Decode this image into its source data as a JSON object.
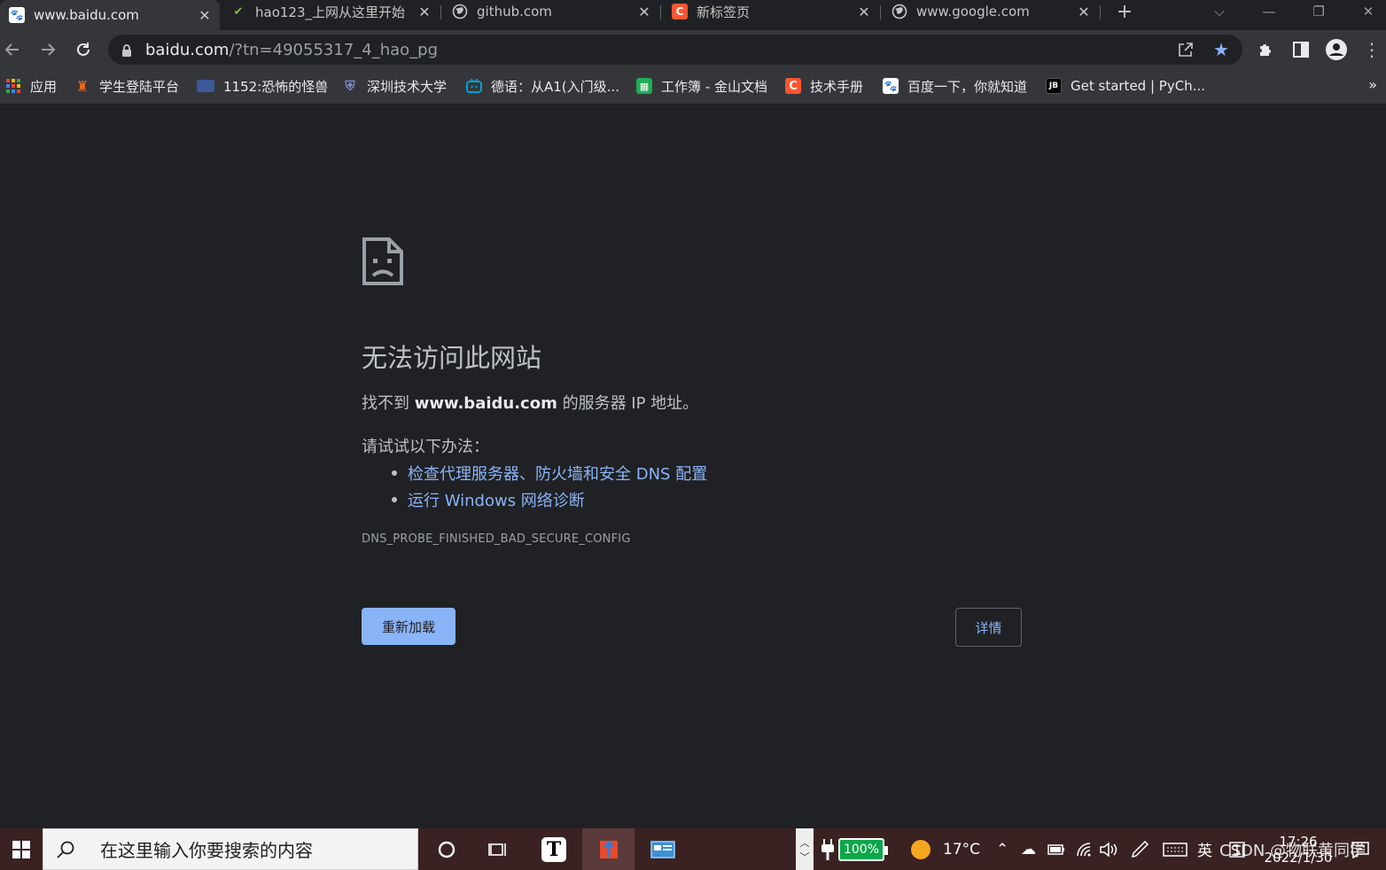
{
  "tabs": [
    {
      "title": "www.baidu.com",
      "active": true
    },
    {
      "title": "hao123_上网从这里开始",
      "active": false
    },
    {
      "title": "github.com",
      "active": false
    },
    {
      "title": "新标签页",
      "active": false
    },
    {
      "title": "www.google.com",
      "active": false
    }
  ],
  "toolbar": {
    "url_host": "baidu.com",
    "url_path": "/?tn=49055317_4_hao_pg"
  },
  "bookmarks": [
    {
      "label": "应用",
      "icon": "apps-grid-icon"
    },
    {
      "label": "学生登陆平台",
      "icon": "shield-bookmark-icon"
    },
    {
      "label": "1152:恐怖的怪兽",
      "icon": "image-bookmark-icon"
    },
    {
      "label": "深圳技术大学",
      "icon": "university-bookmark-icon"
    },
    {
      "label": "德语：从A1(入门级...",
      "icon": "bilibili-icon"
    },
    {
      "label": "工作簿 - 金山文档",
      "icon": "spreadsheet-icon"
    },
    {
      "label": "技术手册",
      "icon": "csdn-icon"
    },
    {
      "label": "百度一下，你就知道",
      "icon": "baidu-paw-icon"
    },
    {
      "label": "Get started | PyCh...",
      "icon": "jetbrains-icon"
    }
  ],
  "error": {
    "title": "无法访问此网站",
    "desc_prefix": "找不到 ",
    "desc_host": "www.baidu.com",
    "desc_suffix": " 的服务器 IP 地址。",
    "try_label": "请试试以下办法：",
    "suggestions": [
      "检查代理服务器、防火墙和安全 DNS 配置",
      "运行 Windows 网络诊断"
    ],
    "code": "DNS_PROBE_FINISHED_BAD_SECURE_CONFIG",
    "reload_label": "重新加载",
    "details_label": "详情"
  },
  "taskbar": {
    "search_placeholder": "在这里输入你要搜索的内容",
    "battery": "100%",
    "temperature": "17°C",
    "ime": "英",
    "time": "17:26",
    "date": "2022/1/30",
    "watermark": "CSDN @物联黄同学"
  },
  "colors": {
    "accent": "#8ab4f8",
    "page_bg": "#202124",
    "toolbar_bg": "#35363a",
    "bookmark_star": "#8ab4f8",
    "battery_green": "#0aa84b"
  }
}
